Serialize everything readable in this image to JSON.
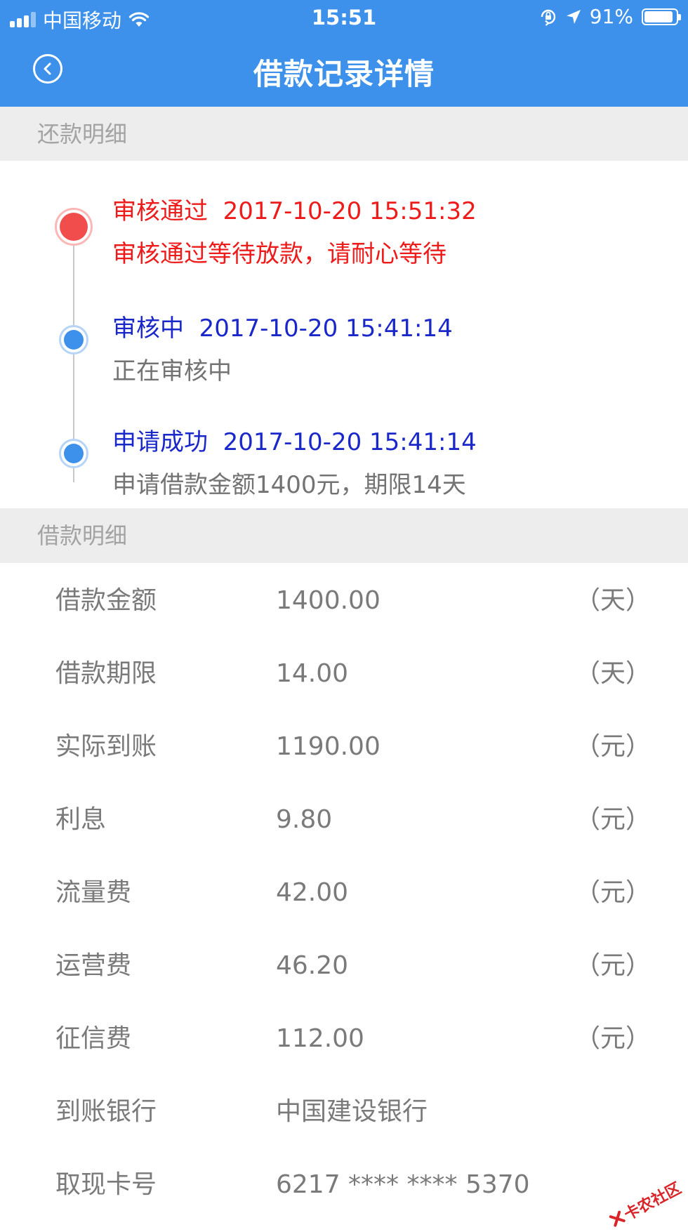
{
  "status_bar": {
    "carrier": "中国移动",
    "time": "15:51",
    "battery": "91%",
    "battery_level": 0.91
  },
  "header": {
    "title": "借款记录详情"
  },
  "repayment_section": {
    "title": "还款明细",
    "events": [
      {
        "status": "审核通过",
        "time": "2017-10-20 15:51:32",
        "desc": "审核通过等待放款，请耐心等待"
      },
      {
        "status": "审核中",
        "time": "2017-10-20 15:41:14",
        "desc": "正在审核中"
      },
      {
        "status": "申请成功",
        "time": "2017-10-20 15:41:14",
        "desc": "申请借款金额1400元，期限14天"
      }
    ]
  },
  "loan_section": {
    "title": "借款明细",
    "rows": [
      {
        "label": "借款金额",
        "value": "1400.00",
        "unit": "（天）"
      },
      {
        "label": "借款期限",
        "value": "14.00",
        "unit": "（天）"
      },
      {
        "label": "实际到账",
        "value": "1190.00",
        "unit": "（元）"
      },
      {
        "label": "利息",
        "value": "9.80",
        "unit": "（元）"
      },
      {
        "label": "流量费",
        "value": "42.00",
        "unit": "（元）"
      },
      {
        "label": "运营费",
        "value": "46.20",
        "unit": "（元）"
      },
      {
        "label": "征信费",
        "value": "112.00",
        "unit": "（元）"
      },
      {
        "label": "到账银行",
        "value": "中国建设银行",
        "unit": ""
      },
      {
        "label": "取现卡号",
        "value": "6217 **** **** 5370",
        "unit": ""
      }
    ]
  },
  "watermark": {
    "text": "卡农社区"
  },
  "colors": {
    "header_bg": "#3d91ea",
    "approved_red": "#ee1b1b",
    "pending_blue": "#1a28c9",
    "section_bg": "#ededed"
  }
}
